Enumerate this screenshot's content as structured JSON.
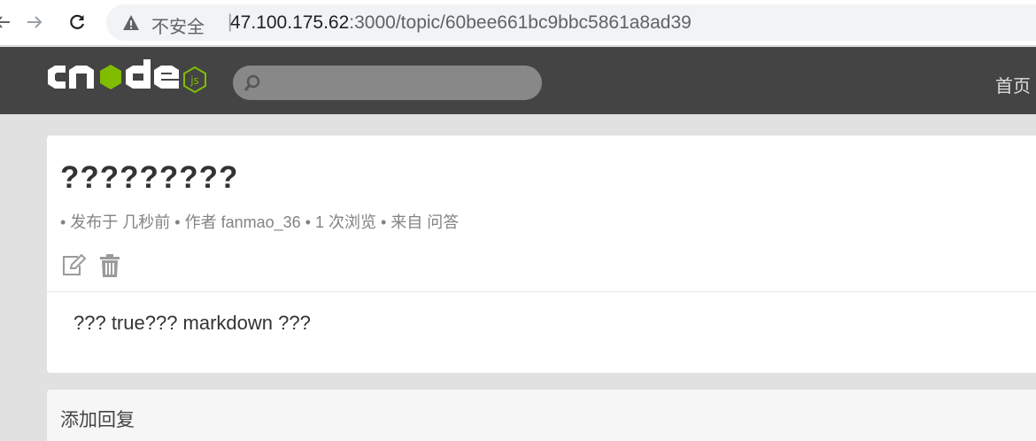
{
  "browser": {
    "not_secure": "不安全",
    "separator": "|",
    "url_host": "47.100.175.62",
    "url_rest": ":3000/topic/60bee661bc9bbc5861a8ad39",
    "icons": [
      "back-arrow-icon",
      "forward-arrow-icon",
      "reload-icon",
      "warning-icon"
    ]
  },
  "navbar": {
    "logo_icon": "cnodejs-logo",
    "search_placeholder": "",
    "home_link": "首页",
    "colors": {
      "bar": "#444444",
      "search": "#888888",
      "logo_green": "#80bd01"
    }
  },
  "topic": {
    "title": "?????????",
    "meta": "• 发布于 几秒前 • 作者 fanmao_36 • 1 次浏览 • 来自 问答",
    "body": "??? true??? markdown ???",
    "icons": [
      "edit-icon",
      "trash-icon"
    ]
  },
  "reply": {
    "header": "添加回复"
  }
}
